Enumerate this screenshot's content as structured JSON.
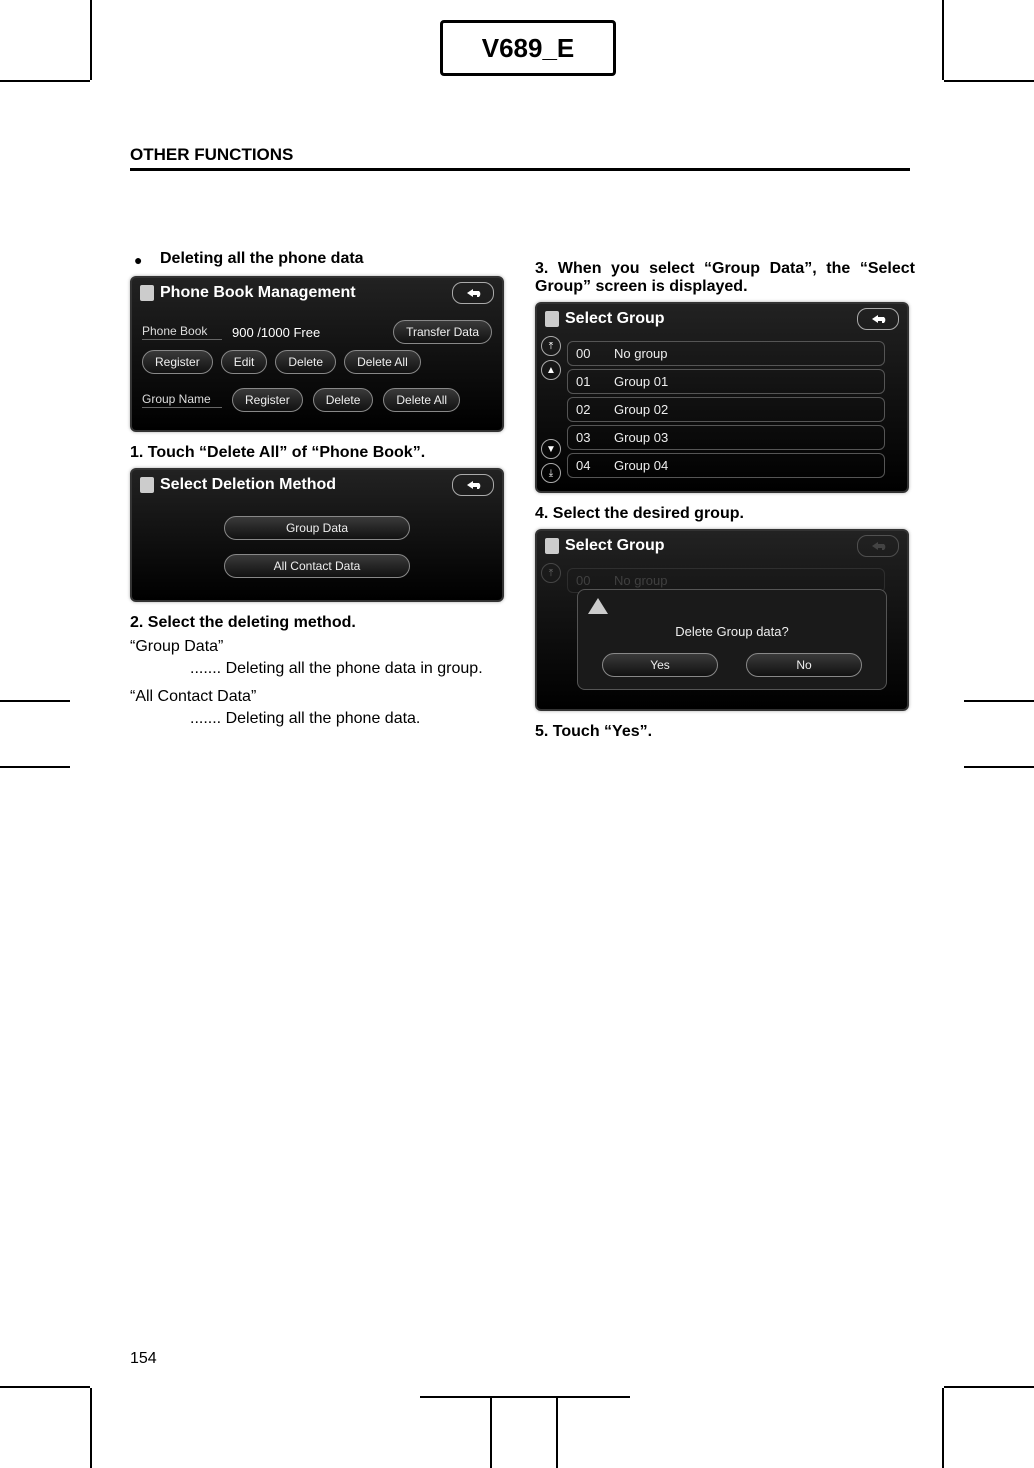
{
  "doc_code": "V689_E",
  "section_title": "OTHER FUNCTIONS",
  "page_number": "154",
  "left": {
    "bullet_title": "Deleting all the phone data",
    "ui_phonebook": {
      "title": "Phone Book Management",
      "row1_label": "Phone Book",
      "free_text": "900 /1000 Free",
      "transfer_btn": "Transfer Data",
      "register_btn": "Register",
      "edit_btn": "Edit",
      "delete_btn": "Delete",
      "delete_all_btn": "Delete All",
      "row2_label": "Group Name",
      "g_register_btn": "Register",
      "g_delete_btn": "Delete",
      "g_delete_all_btn": "Delete All"
    },
    "step1": "1.  Touch  “Delete  All”  of  “Phone Book”.",
    "ui_select_del": {
      "title": "Select Deletion Method",
      "opt1": "Group Data",
      "opt2": "All Contact Data"
    },
    "step2": "2.  Select the deleting method.",
    "gd_label": "“Group Data”",
    "gd_desc": "Deleting all the phone data in group.",
    "acd_label": "“All Contact Data”",
    "acd_desc": "Deleting all the phone data."
  },
  "right": {
    "step3": "3.  When you select “Group Data”, the “Select Group” screen is displayed.",
    "ui_group_list": {
      "title": "Select Group",
      "items": [
        {
          "num": "00",
          "label": "No group"
        },
        {
          "num": "01",
          "label": "Group 01"
        },
        {
          "num": "02",
          "label": "Group 02"
        },
        {
          "num": "03",
          "label": "Group 03"
        },
        {
          "num": "04",
          "label": "Group 04"
        }
      ]
    },
    "step4": "4.  Select the desired group.",
    "ui_confirm": {
      "title": "Select Group",
      "bg_num": "00",
      "bg_label": "No group",
      "modal_msg": "Delete Group data?",
      "yes": "Yes",
      "no": "No"
    },
    "step5": "5.  Touch “Yes”."
  }
}
